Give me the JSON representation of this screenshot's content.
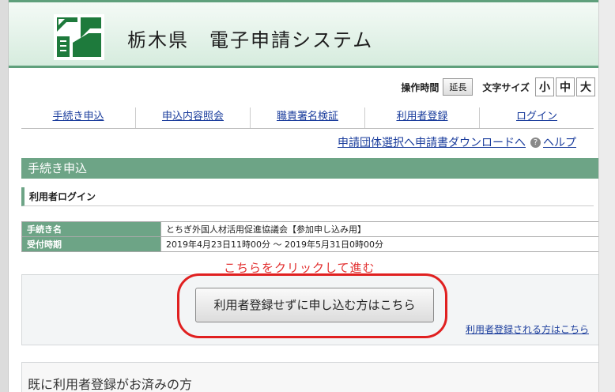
{
  "header": {
    "title": "栃木県　電子申請システム",
    "logo_icon": "tochigi-prefecture-logo"
  },
  "controls": {
    "time_label": "操作時間",
    "extend_label": "延長",
    "font_label": "文字サイズ",
    "font_sizes": [
      "小",
      "中",
      "大"
    ]
  },
  "nav": {
    "items": [
      {
        "label": "手続き申込"
      },
      {
        "label": "申込内容照会"
      },
      {
        "label": "職責署名検証"
      },
      {
        "label": "利用者登録"
      },
      {
        "label": "ログイン"
      }
    ]
  },
  "sublinks": {
    "group_select": "申請団体選択へ",
    "download": "申請書ダウンロードへ",
    "help": "ヘルプ"
  },
  "section": {
    "title": "手続き申込",
    "subtitle": "利用者ログイン"
  },
  "info_table": {
    "rows": [
      {
        "label": "手続き名",
        "value": "とちぎ外国人材活用促進協議会【参加申し込み用】"
      },
      {
        "label": "受付時期",
        "value": "2019年4月23日11時00分 〜 2019年5月31日0時00分"
      }
    ]
  },
  "annotation": "こちらをクリックして進む",
  "actions": {
    "main_button": "利用者登録せずに申し込む方はこちら",
    "register_link": "利用者登録される方はこちら"
  },
  "bottom": {
    "title": "既に利用者登録がお済みの方"
  },
  "colors": {
    "accent": "#6da486",
    "link": "#1a3c9c",
    "annotation": "#e02020"
  }
}
